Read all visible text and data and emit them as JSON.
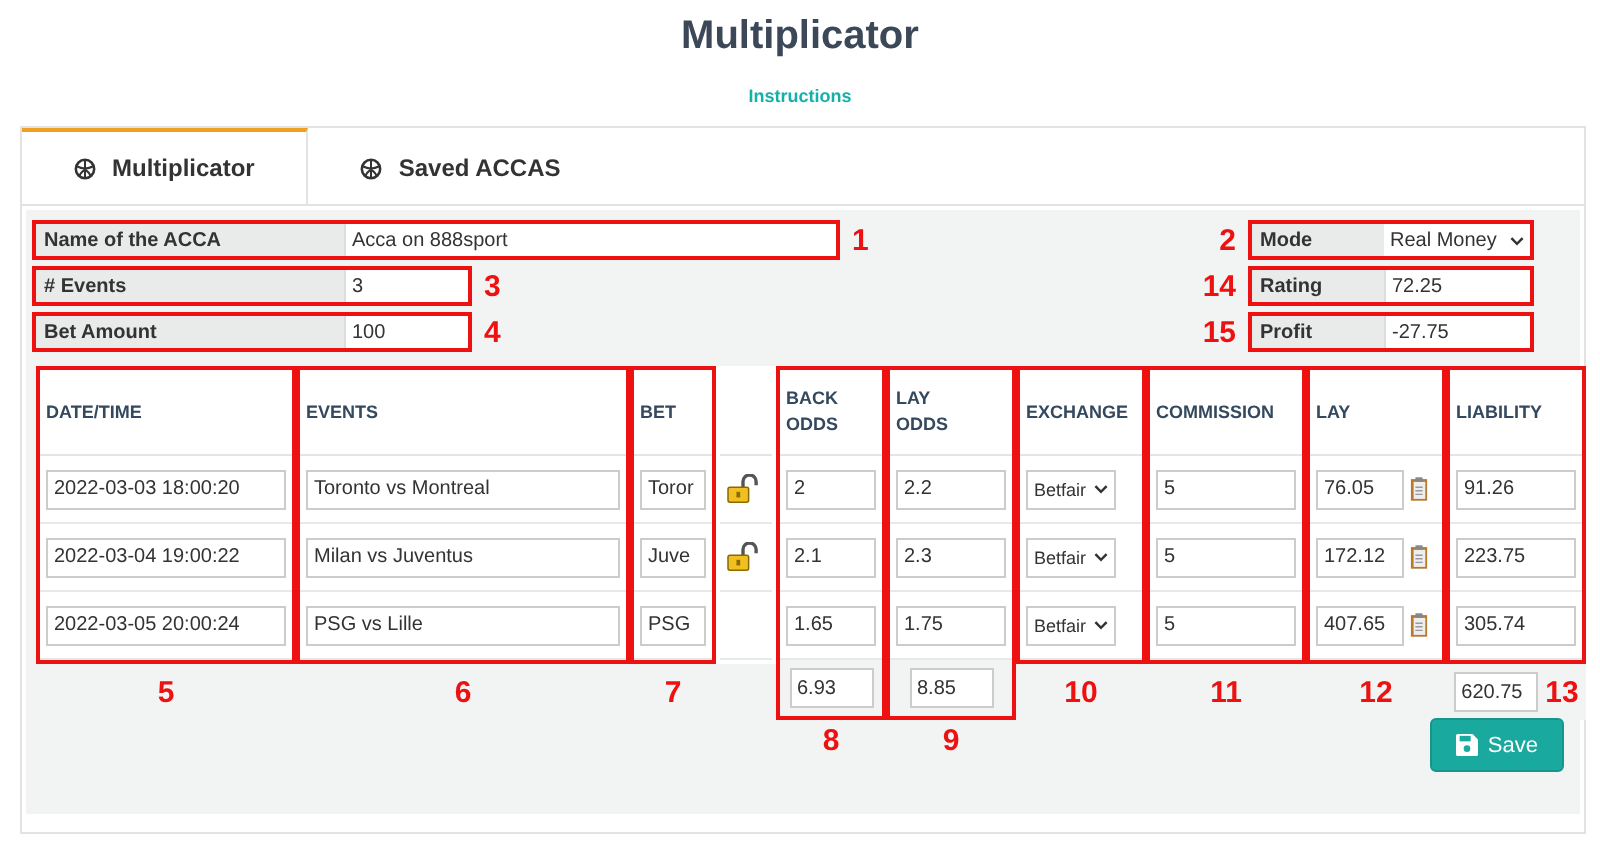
{
  "title": "Multiplicator",
  "instructions_link": "Instructions",
  "tabs": [
    {
      "label": "Multiplicator",
      "selected": true
    },
    {
      "label": "Saved ACCAS",
      "selected": false
    }
  ],
  "form_left": [
    {
      "label": "Name of the ACCA",
      "value": "Acca on 888sport",
      "callout": "1"
    },
    {
      "label": "# Events",
      "value": "3",
      "callout": "3"
    },
    {
      "label": "Bet Amount",
      "value": "100",
      "callout": "4"
    }
  ],
  "form_right": [
    {
      "kind": "select",
      "label": "Mode",
      "value": "Real Money",
      "callout": "2"
    },
    {
      "kind": "input",
      "label": "Rating",
      "value": "72.25",
      "callout": "14"
    },
    {
      "kind": "input",
      "label": "Profit",
      "value": "-27.75",
      "callout": "15"
    }
  ],
  "table": {
    "columns": [
      {
        "kind": "date",
        "heading": "DATE/TIME",
        "callout": "5"
      },
      {
        "kind": "event",
        "heading": "EVENTS",
        "callout": "6"
      },
      {
        "kind": "bet",
        "heading": "BET",
        "callout": "7"
      },
      {
        "kind": "lock"
      },
      {
        "kind": "back_odds",
        "heading": "BACK ODDS",
        "callout": "8",
        "total": "6.93"
      },
      {
        "kind": "lay_odds",
        "heading": "LAY ODDS",
        "callout": "9",
        "total": "8.85"
      },
      {
        "kind": "exchange",
        "heading": "EXCHANGE",
        "callout": "10"
      },
      {
        "kind": "commission",
        "heading": "COMMISSION",
        "callout": "11"
      },
      {
        "kind": "lay",
        "heading": "LAY",
        "callout": "12"
      },
      {
        "kind": "liability",
        "heading": "LIABILITY",
        "callout": "13",
        "total": "620.75"
      }
    ],
    "rows": [
      {
        "date": "2022-03-03 18:00:20",
        "event": "Toronto vs Montreal",
        "bet": "Toror",
        "lock": true,
        "back_odds": "2",
        "lay_odds": "2.2",
        "exchange": "Betfair",
        "commission": "5",
        "lay": "76.05",
        "liability": "91.26"
      },
      {
        "date": "2022-03-04 19:00:22",
        "event": "Milan vs Juventus",
        "bet": "Juve",
        "lock": true,
        "back_odds": "2.1",
        "lay_odds": "2.3",
        "exchange": "Betfair",
        "commission": "5",
        "lay": "172.12",
        "liability": "223.75"
      },
      {
        "date": "2022-03-05 20:00:24",
        "event": "PSG vs Lille",
        "bet": "PSG",
        "lock": false,
        "back_odds": "1.65",
        "lay_odds": "1.75",
        "exchange": "Betfair",
        "commission": "5",
        "lay": "407.65",
        "liability": "305.74"
      }
    ]
  },
  "save_button": "Save"
}
